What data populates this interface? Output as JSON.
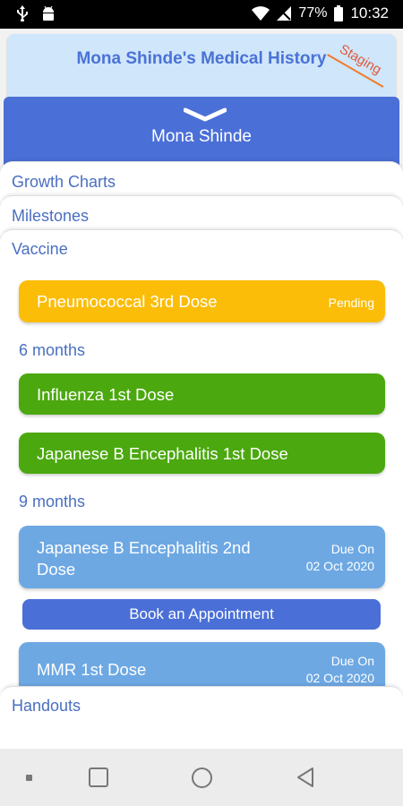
{
  "status_bar": {
    "battery": "77%",
    "time": "10:32",
    "icons": [
      "usb-icon",
      "android-debug-icon",
      "wifi-icon",
      "no-signal-icon",
      "battery-icon"
    ]
  },
  "header": {
    "title": "Mona Shinde's Medical History",
    "badge": "Staging",
    "background": "#cfe6fb"
  },
  "patient": {
    "name": "Mona Shinde",
    "bar_color": "#4a6fd7"
  },
  "sections": {
    "growth": "Growth Charts",
    "milestones": "Milestones",
    "vaccine": "Vaccine",
    "handouts": "Handouts"
  },
  "vaccines": {
    "pending_card": {
      "title": "Pneumococcal 3rd Dose",
      "status": "Pending"
    },
    "group_6m": "6 months",
    "influenza": {
      "title": "Influenza 1st Dose"
    },
    "jbe1": {
      "title": "Japanese B Encephalitis 1st Dose"
    },
    "group_9m": "9 months",
    "jbe2": {
      "title_line1": "Japanese B Encephalitis 2nd",
      "title_line2": "Dose",
      "due_label": "Due On",
      "due_date": "02 Oct 2020"
    },
    "book_button": "Book an Appointment",
    "mmr": {
      "title": "MMR 1st Dose",
      "due_label": "Due On",
      "due_date": "02 Oct 2020"
    }
  },
  "colors": {
    "pending": "#fbbd08",
    "done": "#4ba80e",
    "due": "#6da8e3",
    "accent": "#4a6fd7"
  },
  "nav": {
    "icons": [
      "recent-dot-icon",
      "overview-square-icon",
      "home-circle-icon",
      "back-triangle-icon"
    ]
  }
}
